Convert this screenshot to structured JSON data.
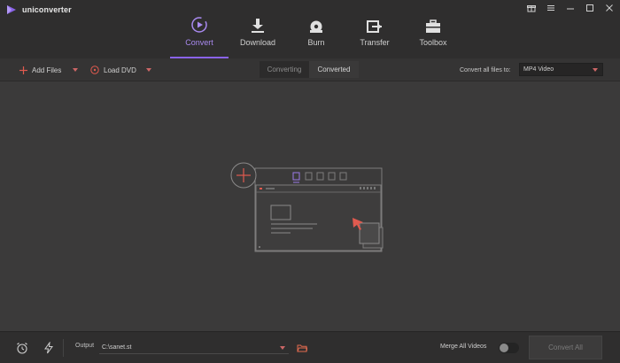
{
  "app": {
    "name": "uniconverter"
  },
  "colors": {
    "accent": "#8a63e8",
    "active_tab_text": "#a98af0",
    "caret": "#cc6666",
    "add_circle": "#e05a4f"
  },
  "nav": {
    "tabs": [
      {
        "label": "Convert",
        "icon": "convert-icon",
        "active": true
      },
      {
        "label": "Download",
        "icon": "download-icon",
        "active": false
      },
      {
        "label": "Burn",
        "icon": "burn-icon",
        "active": false
      },
      {
        "label": "Transfer",
        "icon": "transfer-icon",
        "active": false
      },
      {
        "label": "Toolbox",
        "icon": "toolbox-icon",
        "active": false
      }
    ]
  },
  "toolbar": {
    "add_files": "Add Files",
    "load_dvd": "Load DVD",
    "segments": {
      "converting": "Converting",
      "converted": "Converted"
    },
    "convert_to_label": "Convert all files to:",
    "format_value": "MP4 Video"
  },
  "bottombar": {
    "output_label": "Output",
    "output_path": "C:\\sanet.st",
    "merge_label": "Merge All Videos",
    "merge_enabled": false,
    "convert_all": "Convert All"
  }
}
